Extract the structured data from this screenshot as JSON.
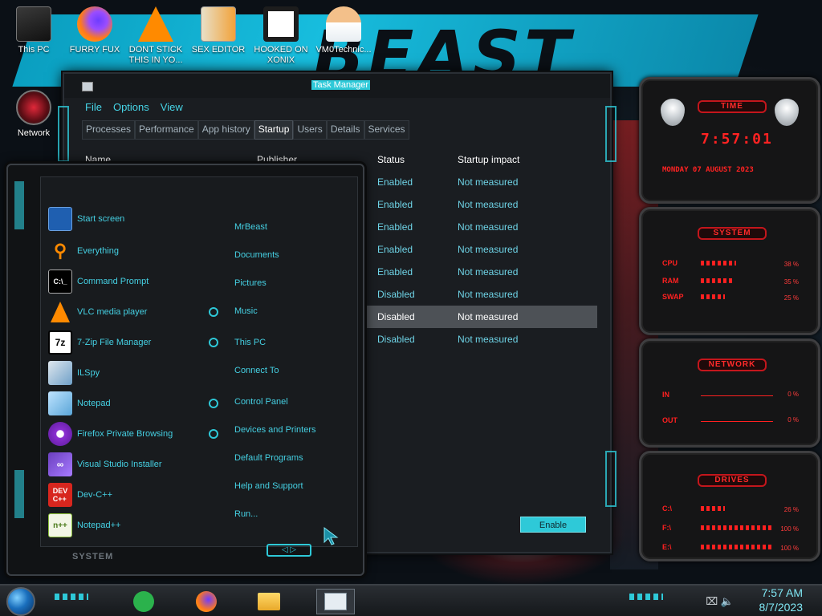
{
  "desktop": {
    "icons": [
      {
        "label": "This PC",
        "icon": "this-pc-icon"
      },
      {
        "label": "FURRY FUX",
        "icon": "firefox-icon"
      },
      {
        "label": "DONT STICK THIS IN YO...",
        "icon": "vlc-icon"
      },
      {
        "label": "SEX EDITOR",
        "icon": "hxd-editor-icon"
      },
      {
        "label": "HOOKED ON XONIX",
        "icon": "game-icon"
      },
      {
        "label": "VM0Technic...",
        "icon": "doctor-icon"
      },
      {
        "label": "Network",
        "icon": "network-icon"
      }
    ]
  },
  "task_manager": {
    "title": "Task Manager",
    "menu": [
      "File",
      "Options",
      "View"
    ],
    "tabs": [
      "Processes",
      "Performance",
      "App history",
      "Startup",
      "Users",
      "Details",
      "Services"
    ],
    "active_tab": "Startup",
    "columns": [
      "Name",
      "Publisher",
      "Status",
      "Startup impact"
    ],
    "rows": [
      {
        "status": "Enabled",
        "impact": "Not measured"
      },
      {
        "status": "Enabled",
        "impact": "Not measured"
      },
      {
        "status": "Enabled",
        "impact": "Not measured"
      },
      {
        "status": "Enabled",
        "impact": "Not measured"
      },
      {
        "status": "Enabled",
        "impact": "Not measured"
      },
      {
        "status": "Disabled",
        "impact": "Not measured"
      },
      {
        "status": "Disabled",
        "impact": "Not measured"
      },
      {
        "status": "Disabled",
        "impact": "Not measured"
      }
    ],
    "enable_button": "Enable"
  },
  "start_menu": {
    "programs": [
      {
        "label": "Start screen",
        "icon": "start-screen-icon"
      },
      {
        "label": "Everything",
        "icon": "search-icon"
      },
      {
        "label": "Command Prompt",
        "icon": "cmd-icon"
      },
      {
        "label": "VLC media player",
        "icon": "vlc-icon"
      },
      {
        "label": "7-Zip File Manager",
        "icon": "zip-icon"
      },
      {
        "label": "ILSpy",
        "icon": "ilspy-icon"
      },
      {
        "label": "Notepad",
        "icon": "notepad-icon"
      },
      {
        "label": "Firefox Private Browsing",
        "icon": "private-browsing-icon"
      },
      {
        "label": "Visual Studio Installer",
        "icon": "vs-installer-icon"
      },
      {
        "label": "Dev-C++",
        "icon": "devcpp-icon"
      },
      {
        "label": "Notepad++",
        "icon": "notepadpp-icon"
      }
    ],
    "places": [
      "MrBeast",
      "Documents",
      "Pictures",
      "Music",
      "This PC",
      "Connect To",
      "Control Panel",
      "Devices and Printers",
      "Default Programs",
      "Help and Support",
      "Run..."
    ],
    "system_label": "SYSTEM"
  },
  "gadgets": {
    "time": {
      "title": "TIME",
      "time": "7:57:01",
      "date": "MONDAY 07 AUGUST 2023"
    },
    "system": {
      "title": "SYSTEM",
      "rows": [
        {
          "label": "CPU",
          "value": "38 %",
          "level": 0.38
        },
        {
          "label": "RAM",
          "value": "35 %",
          "level": 0.35
        },
        {
          "label": "SWAP",
          "value": "25 %",
          "level": 0.25
        }
      ]
    },
    "network": {
      "title": "NETWORK",
      "rows": [
        {
          "label": "IN",
          "value": "0 %"
        },
        {
          "label": "OUT",
          "value": "0 %"
        }
      ]
    },
    "drives": {
      "title": "DRIVES",
      "rows": [
        {
          "label": "C:\\",
          "value": "26 %",
          "level": 0.26
        },
        {
          "label": "F:\\",
          "value": "100 %",
          "level": 1.0
        },
        {
          "label": "E:\\",
          "value": "100 %",
          "level": 1.0
        }
      ]
    }
  },
  "taskbar": {
    "apps": [
      "feedly-icon",
      "firefox-icon",
      "file-explorer-icon",
      "task-manager-icon"
    ],
    "time": "7:57 AM",
    "date": "8/7/2023"
  },
  "colors": {
    "accent": "#2ec9d8",
    "gadget_red": "#ff2020",
    "window_bg": "#1a1d21"
  }
}
